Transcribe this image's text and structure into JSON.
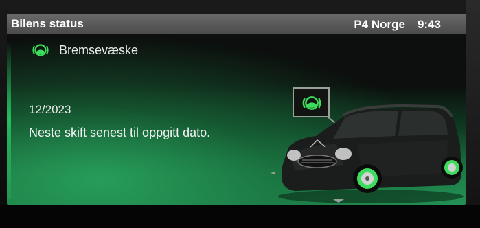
{
  "header": {
    "title": "Bilens status",
    "radio_station": "P4 Norge",
    "clock": "9:43"
  },
  "status_item": {
    "icon": "brake-fluid-icon",
    "label": "Bremsevæske",
    "due_date": "12/2023",
    "message": "Neste skift senest til oppgitt dato."
  },
  "colors": {
    "accent_green": "#3ddc5c",
    "title_bar": "#5a5a5a",
    "text": "#ececec"
  }
}
